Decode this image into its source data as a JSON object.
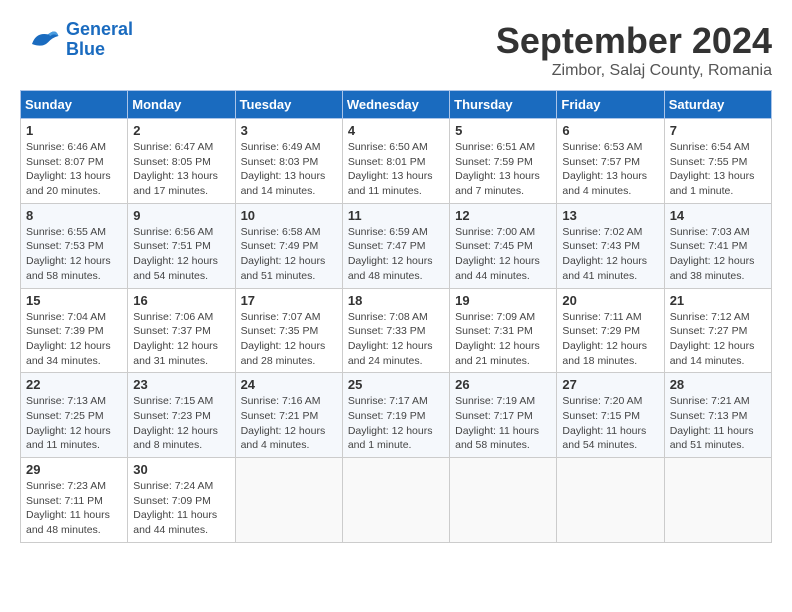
{
  "header": {
    "logo_line1": "General",
    "logo_line2": "Blue",
    "title": "September 2024",
    "subtitle": "Zimbor, Salaj County, Romania"
  },
  "calendar": {
    "days_of_week": [
      "Sunday",
      "Monday",
      "Tuesday",
      "Wednesday",
      "Thursday",
      "Friday",
      "Saturday"
    ],
    "weeks": [
      [
        null,
        null,
        null,
        null,
        null,
        null,
        null
      ]
    ],
    "cells": [
      {
        "day": null,
        "sunrise": "",
        "sunset": "",
        "daylight": ""
      },
      {
        "day": null,
        "sunrise": "",
        "sunset": "",
        "daylight": ""
      },
      {
        "day": null,
        "sunrise": "",
        "sunset": "",
        "daylight": ""
      },
      {
        "day": null,
        "sunrise": "",
        "sunset": "",
        "daylight": ""
      },
      {
        "day": null,
        "sunrise": "",
        "sunset": "",
        "daylight": ""
      },
      {
        "day": null,
        "sunrise": "",
        "sunset": "",
        "daylight": ""
      },
      {
        "day": null,
        "sunrise": "",
        "sunset": "",
        "daylight": ""
      }
    ]
  },
  "days": [
    {
      "num": "1",
      "sunrise": "Sunrise: 6:46 AM",
      "sunset": "Sunset: 8:07 PM",
      "daylight": "Daylight: 13 hours and 20 minutes."
    },
    {
      "num": "2",
      "sunrise": "Sunrise: 6:47 AM",
      "sunset": "Sunset: 8:05 PM",
      "daylight": "Daylight: 13 hours and 17 minutes."
    },
    {
      "num": "3",
      "sunrise": "Sunrise: 6:49 AM",
      "sunset": "Sunset: 8:03 PM",
      "daylight": "Daylight: 13 hours and 14 minutes."
    },
    {
      "num": "4",
      "sunrise": "Sunrise: 6:50 AM",
      "sunset": "Sunset: 8:01 PM",
      "daylight": "Daylight: 13 hours and 11 minutes."
    },
    {
      "num": "5",
      "sunrise": "Sunrise: 6:51 AM",
      "sunset": "Sunset: 7:59 PM",
      "daylight": "Daylight: 13 hours and 7 minutes."
    },
    {
      "num": "6",
      "sunrise": "Sunrise: 6:53 AM",
      "sunset": "Sunset: 7:57 PM",
      "daylight": "Daylight: 13 hours and 4 minutes."
    },
    {
      "num": "7",
      "sunrise": "Sunrise: 6:54 AM",
      "sunset": "Sunset: 7:55 PM",
      "daylight": "Daylight: 13 hours and 1 minute."
    },
    {
      "num": "8",
      "sunrise": "Sunrise: 6:55 AM",
      "sunset": "Sunset: 7:53 PM",
      "daylight": "Daylight: 12 hours and 58 minutes."
    },
    {
      "num": "9",
      "sunrise": "Sunrise: 6:56 AM",
      "sunset": "Sunset: 7:51 PM",
      "daylight": "Daylight: 12 hours and 54 minutes."
    },
    {
      "num": "10",
      "sunrise": "Sunrise: 6:58 AM",
      "sunset": "Sunset: 7:49 PM",
      "daylight": "Daylight: 12 hours and 51 minutes."
    },
    {
      "num": "11",
      "sunrise": "Sunrise: 6:59 AM",
      "sunset": "Sunset: 7:47 PM",
      "daylight": "Daylight: 12 hours and 48 minutes."
    },
    {
      "num": "12",
      "sunrise": "Sunrise: 7:00 AM",
      "sunset": "Sunset: 7:45 PM",
      "daylight": "Daylight: 12 hours and 44 minutes."
    },
    {
      "num": "13",
      "sunrise": "Sunrise: 7:02 AM",
      "sunset": "Sunset: 7:43 PM",
      "daylight": "Daylight: 12 hours and 41 minutes."
    },
    {
      "num": "14",
      "sunrise": "Sunrise: 7:03 AM",
      "sunset": "Sunset: 7:41 PM",
      "daylight": "Daylight: 12 hours and 38 minutes."
    },
    {
      "num": "15",
      "sunrise": "Sunrise: 7:04 AM",
      "sunset": "Sunset: 7:39 PM",
      "daylight": "Daylight: 12 hours and 34 minutes."
    },
    {
      "num": "16",
      "sunrise": "Sunrise: 7:06 AM",
      "sunset": "Sunset: 7:37 PM",
      "daylight": "Daylight: 12 hours and 31 minutes."
    },
    {
      "num": "17",
      "sunrise": "Sunrise: 7:07 AM",
      "sunset": "Sunset: 7:35 PM",
      "daylight": "Daylight: 12 hours and 28 minutes."
    },
    {
      "num": "18",
      "sunrise": "Sunrise: 7:08 AM",
      "sunset": "Sunset: 7:33 PM",
      "daylight": "Daylight: 12 hours and 24 minutes."
    },
    {
      "num": "19",
      "sunrise": "Sunrise: 7:09 AM",
      "sunset": "Sunset: 7:31 PM",
      "daylight": "Daylight: 12 hours and 21 minutes."
    },
    {
      "num": "20",
      "sunrise": "Sunrise: 7:11 AM",
      "sunset": "Sunset: 7:29 PM",
      "daylight": "Daylight: 12 hours and 18 minutes."
    },
    {
      "num": "21",
      "sunrise": "Sunrise: 7:12 AM",
      "sunset": "Sunset: 7:27 PM",
      "daylight": "Daylight: 12 hours and 14 minutes."
    },
    {
      "num": "22",
      "sunrise": "Sunrise: 7:13 AM",
      "sunset": "Sunset: 7:25 PM",
      "daylight": "Daylight: 12 hours and 11 minutes."
    },
    {
      "num": "23",
      "sunrise": "Sunrise: 7:15 AM",
      "sunset": "Sunset: 7:23 PM",
      "daylight": "Daylight: 12 hours and 8 minutes."
    },
    {
      "num": "24",
      "sunrise": "Sunrise: 7:16 AM",
      "sunset": "Sunset: 7:21 PM",
      "daylight": "Daylight: 12 hours and 4 minutes."
    },
    {
      "num": "25",
      "sunrise": "Sunrise: 7:17 AM",
      "sunset": "Sunset: 7:19 PM",
      "daylight": "Daylight: 12 hours and 1 minute."
    },
    {
      "num": "26",
      "sunrise": "Sunrise: 7:19 AM",
      "sunset": "Sunset: 7:17 PM",
      "daylight": "Daylight: 11 hours and 58 minutes."
    },
    {
      "num": "27",
      "sunrise": "Sunrise: 7:20 AM",
      "sunset": "Sunset: 7:15 PM",
      "daylight": "Daylight: 11 hours and 54 minutes."
    },
    {
      "num": "28",
      "sunrise": "Sunrise: 7:21 AM",
      "sunset": "Sunset: 7:13 PM",
      "daylight": "Daylight: 11 hours and 51 minutes."
    },
    {
      "num": "29",
      "sunrise": "Sunrise: 7:23 AM",
      "sunset": "Sunset: 7:11 PM",
      "daylight": "Daylight: 11 hours and 48 minutes."
    },
    {
      "num": "30",
      "sunrise": "Sunrise: 7:24 AM",
      "sunset": "Sunset: 7:09 PM",
      "daylight": "Daylight: 11 hours and 44 minutes."
    }
  ]
}
